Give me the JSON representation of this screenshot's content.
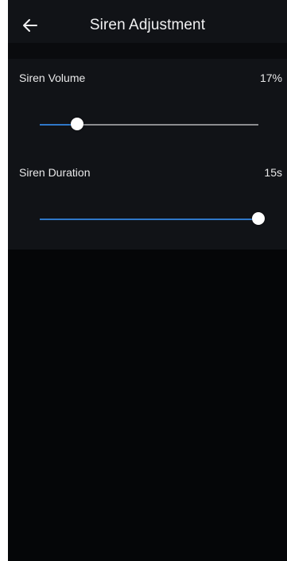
{
  "header": {
    "title": "Siren Adjustment",
    "back_icon": "arrow-left-icon"
  },
  "settings": {
    "volume": {
      "label": "Siren Volume",
      "value_text": "17%",
      "level": 0.17
    },
    "duration": {
      "label": "Siren Duration",
      "value_text": "15s",
      "level": 1.0
    }
  },
  "colors": {
    "background": "#050608",
    "surface": "#111317",
    "accent": "#2f78c8",
    "track": "#8c8d90",
    "text": "#e9e9ea"
  }
}
